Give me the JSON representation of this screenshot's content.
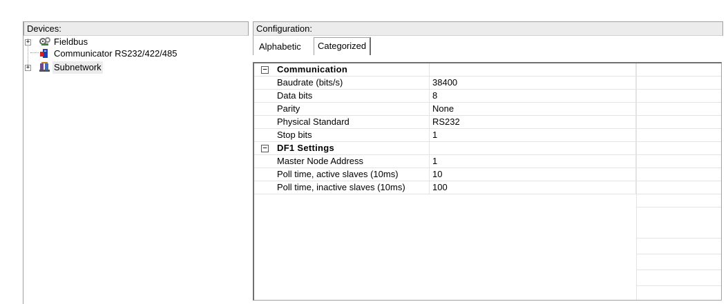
{
  "devices": {
    "header": "Devices:",
    "items": [
      {
        "label": "Fieldbus",
        "icon": "fieldbus-icon",
        "expandable": true
      },
      {
        "label": "Communicator RS232/422/485",
        "icon": "communicator-icon",
        "expandable": false
      },
      {
        "label": "Subnetwork",
        "icon": "subnetwork-icon",
        "expandable": true
      }
    ]
  },
  "configuration": {
    "header": "Configuration:",
    "tabs": {
      "alphabetic": "Alphabetic",
      "categorized": "Categorized"
    },
    "categories": [
      {
        "name": "Communication",
        "toggle": "−",
        "rows": [
          {
            "name": "Baudrate (bits/s)",
            "value": "38400"
          },
          {
            "name": "Data bits",
            "value": "8"
          },
          {
            "name": "Parity",
            "value": "None"
          },
          {
            "name": "Physical Standard",
            "value": "RS232"
          },
          {
            "name": "Stop bits",
            "value": "1"
          }
        ]
      },
      {
        "name": "DF1 Settings",
        "toggle": "−",
        "rows": [
          {
            "name": "Master Node Address",
            "value": "1"
          },
          {
            "name": "Poll time, active slaves (10ms)",
            "value": "10"
          },
          {
            "name": "Poll time, inactive slaves (10ms)",
            "value": "100"
          }
        ]
      }
    ]
  },
  "colors": {
    "border": "#a0a0a0",
    "header_bg": "#ececec",
    "grid_line": "#e3e3e3"
  }
}
